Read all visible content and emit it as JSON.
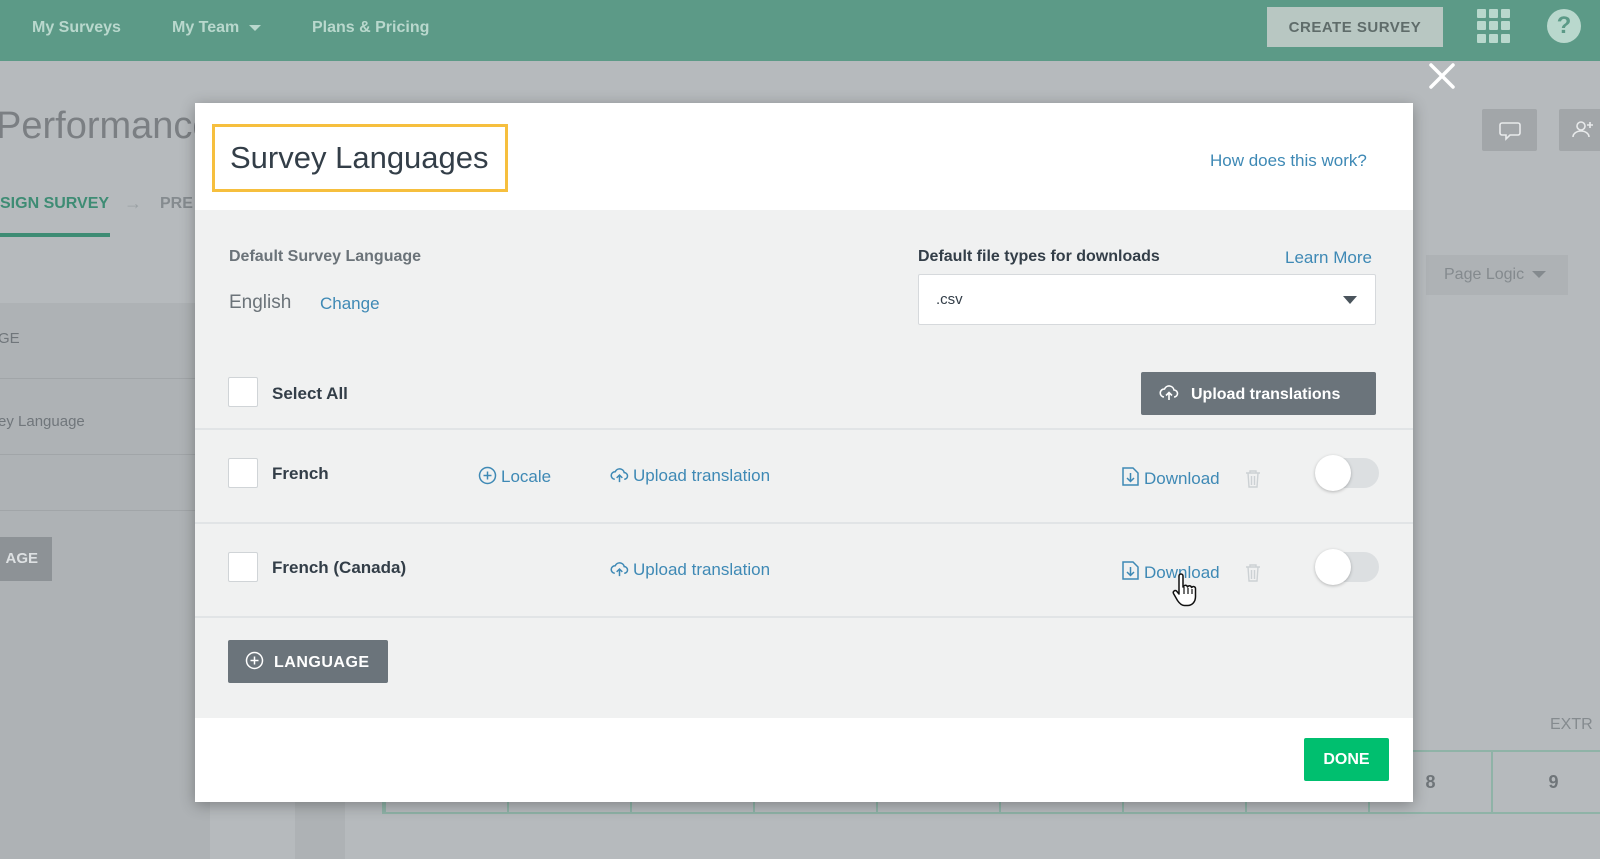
{
  "topnav": {
    "items": [
      "My Surveys",
      "My Team",
      "Plans & Pricing"
    ],
    "create_label": "CREATE SURVEY",
    "help_label": "?"
  },
  "background": {
    "title": "Performance",
    "design_tab": "SIGN SURVEY",
    "preview_tab": "PRE",
    "sidebar_labels": [
      "GE",
      "ey Language"
    ],
    "page_button": "AGE",
    "page_logic": "Page Logic",
    "extra_label": "EXTR",
    "scale_values": [
      "",
      "",
      "",
      "",
      "",
      "",
      "",
      "",
      "8",
      "9"
    ]
  },
  "modal": {
    "title": "Survey Languages",
    "how_link": "How does this work?",
    "default_lang_label": "Default Survey Language",
    "default_lang_value": "English",
    "change_link": "Change",
    "file_types_label": "Default file types for downloads",
    "learn_more_link": "Learn More",
    "file_type_value": ".csv",
    "select_all_label": "Select All",
    "upload_all_label": "Upload translations",
    "languages": [
      {
        "name": "French",
        "locale_label": "Locale",
        "upload_label": "Upload translation",
        "download_label": "Download"
      },
      {
        "name": "French (Canada)",
        "upload_label": "Upload translation",
        "download_label": "Download"
      }
    ],
    "add_language_label": "LANGUAGE",
    "done_label": "DONE"
  },
  "colors": {
    "accent_green": "#00bf6f",
    "nav_green": "#5c9a87",
    "link_blue": "#3e89b5",
    "highlight_yellow": "#f6bf3e"
  }
}
